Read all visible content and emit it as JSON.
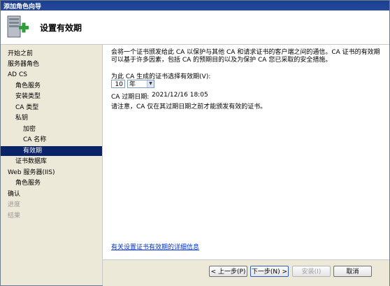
{
  "window": {
    "title": "添加角色向导"
  },
  "banner": {
    "title": "设置有效期",
    "icon": "server-add-icon"
  },
  "sidebar": {
    "items": [
      {
        "label": "开始之前",
        "state": "normal"
      },
      {
        "label": "服务器角色",
        "state": "normal"
      },
      {
        "label": "AD CS",
        "state": "normal"
      },
      {
        "label": "角色服务",
        "state": "normal"
      },
      {
        "label": "安装类型",
        "state": "normal"
      },
      {
        "label": "CA 类型",
        "state": "normal"
      },
      {
        "label": "私钥",
        "state": "normal"
      },
      {
        "label": "加密",
        "state": "normal"
      },
      {
        "label": "CA 名称",
        "state": "normal"
      },
      {
        "label": "有效期",
        "state": "active"
      },
      {
        "label": "证书数据库",
        "state": "normal"
      },
      {
        "label": "Web 服务器(IIS)",
        "state": "normal"
      },
      {
        "label": "角色服务",
        "state": "normal"
      },
      {
        "label": "确认",
        "state": "normal"
      },
      {
        "label": "进度",
        "state": "disabled"
      },
      {
        "label": "结果",
        "state": "disabled"
      }
    ]
  },
  "main": {
    "description": "会将一个证书颁发给此 CA 以保护与其他 CA 和请求证书的客户端之间的通信。CA 证书的有效期可以基于许多因素，包括 CA 的预期目的以及为保护 CA 您已采取的安全措施。",
    "validity_label": "为此 CA 生成的证书选择有效期(V):",
    "validity_value": "10",
    "validity_unit": "年",
    "expiry_label": "CA 过期日期:",
    "expiry_value": "2021/12/16 18:05",
    "note": "请注意，CA 仅在其过期日期之前才能颁发有效的证书。",
    "more_info_link": "有关设置证书有效期的详细信息"
  },
  "footer": {
    "back": "< 上一步(P)",
    "next": "下一步(N) >",
    "install": "安装(I)",
    "cancel": "取消"
  },
  "colors": {
    "title_bar": "#24489c",
    "selection": "#0a246a",
    "link": "#0033cc"
  }
}
